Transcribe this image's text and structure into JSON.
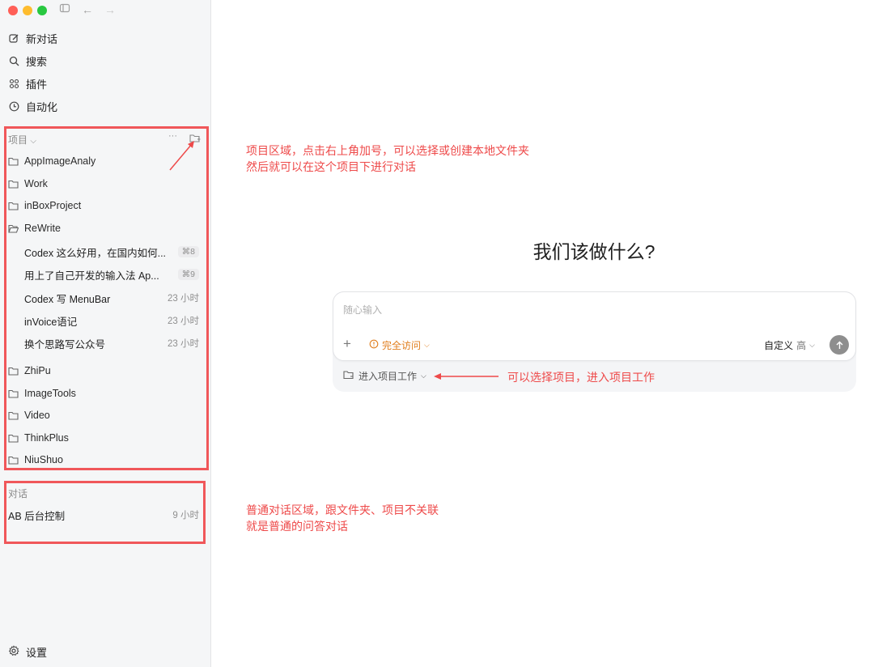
{
  "sidebar": {
    "nav": [
      {
        "label": "新对话",
        "icon": "edit-icon"
      },
      {
        "label": "搜索",
        "icon": "search-icon"
      },
      {
        "label": "插件",
        "icon": "plugins-icon"
      },
      {
        "label": "自动化",
        "icon": "clock-icon"
      }
    ],
    "projects_label": "项目",
    "projects_more": "···",
    "folders_top": [
      "AppImageAnaly",
      "Work",
      "inBoxProject",
      "ReWrite"
    ],
    "rewrite_chats": [
      {
        "title": "Codex 这么好用，在国内如何...",
        "meta": "⌘8",
        "kbd": true
      },
      {
        "title": "用上了自己开发的输入法 Ap...",
        "meta": "⌘9",
        "kbd": true
      },
      {
        "title": "Codex 写 MenuBar",
        "meta": "23 小时",
        "kbd": false
      },
      {
        "title": "inVoice语记",
        "meta": "23 小时",
        "kbd": false
      },
      {
        "title": "换个思路写公众号",
        "meta": "23 小时",
        "kbd": false
      }
    ],
    "folders_bottom": [
      "ZhiPu",
      "ImageTools",
      "Video",
      "ThinkPlus",
      "NiuShuo"
    ],
    "chats_label": "对话",
    "chats": [
      {
        "title": "AB 后台控制",
        "meta": "9 小时"
      }
    ],
    "settings_label": "设置"
  },
  "main": {
    "hero": "我们该做什么?",
    "composer": {
      "placeholder": "随心输入",
      "access_label": "完全访问",
      "custom_label": "自定义",
      "level_label": "高"
    },
    "project_picker": "进入项目工作"
  },
  "annotations": {
    "projects": [
      "项目区域，点击右上角加号，可以选择或创建本地文件夹",
      "然后就可以在这个项目下进行对话"
    ],
    "picker": "可以选择项目，进入项目工作",
    "chats": [
      "普通对话区域，跟文件夹、项目不关联",
      "就是普通的问答对话"
    ]
  },
  "colors": {
    "annotation": "#ee4a4a",
    "access": "#e07d1c",
    "sidebar_bg": "#f5f6f7"
  }
}
